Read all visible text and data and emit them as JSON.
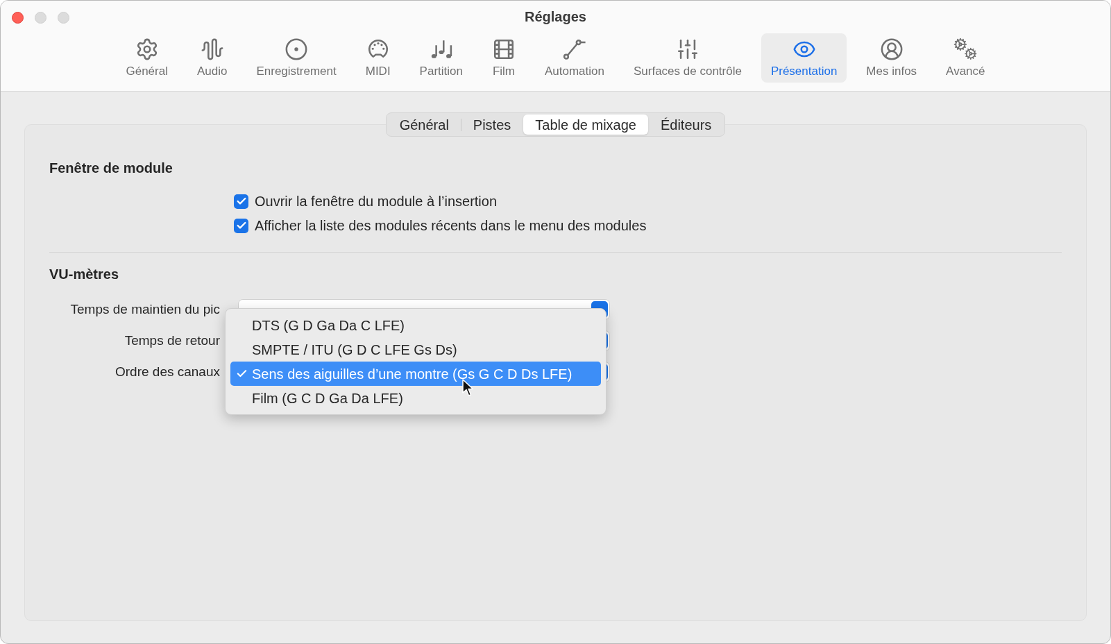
{
  "window": {
    "title": "Réglages"
  },
  "toolbar": [
    {
      "label": "Général",
      "selected": false
    },
    {
      "label": "Audio",
      "selected": false
    },
    {
      "label": "Enregistrement",
      "selected": false
    },
    {
      "label": "MIDI",
      "selected": false
    },
    {
      "label": "Partition",
      "selected": false
    },
    {
      "label": "Film",
      "selected": false
    },
    {
      "label": "Automation",
      "selected": false
    },
    {
      "label": "Surfaces de contrôle",
      "selected": false
    },
    {
      "label": "Présentation",
      "selected": true
    },
    {
      "label": "Mes infos",
      "selected": false
    },
    {
      "label": "Avancé",
      "selected": false
    }
  ],
  "tabs": [
    {
      "label": "Général",
      "selected": false
    },
    {
      "label": "Pistes",
      "selected": false
    },
    {
      "label": "Table de mixage",
      "selected": true
    },
    {
      "label": "Éditeurs",
      "selected": false
    }
  ],
  "plugin_window": {
    "title": "Fenêtre de module",
    "checkboxes": [
      {
        "label": "Ouvrir la fenêtre du module à l’insertion",
        "checked": true
      },
      {
        "label": "Afficher la liste des modules récents dans le menu des modules",
        "checked": true
      }
    ]
  },
  "vu_meters": {
    "title": "VU-mètres",
    "fields": [
      {
        "label": "Temps de maintien du pic"
      },
      {
        "label": "Temps de retour"
      },
      {
        "label": "Ordre des canaux"
      }
    ]
  },
  "menu": {
    "items": [
      {
        "label": "DTS (G D Ga Da C LFE)",
        "selected": false
      },
      {
        "label": "SMPTE / ITU (G D C LFE Gs Ds)",
        "selected": false
      },
      {
        "label": "Sens des aiguilles d’une montre (Gs G C D Ds LFE)",
        "selected": true
      },
      {
        "label": "Film (G C D Ga Da LFE)",
        "selected": false
      }
    ]
  }
}
